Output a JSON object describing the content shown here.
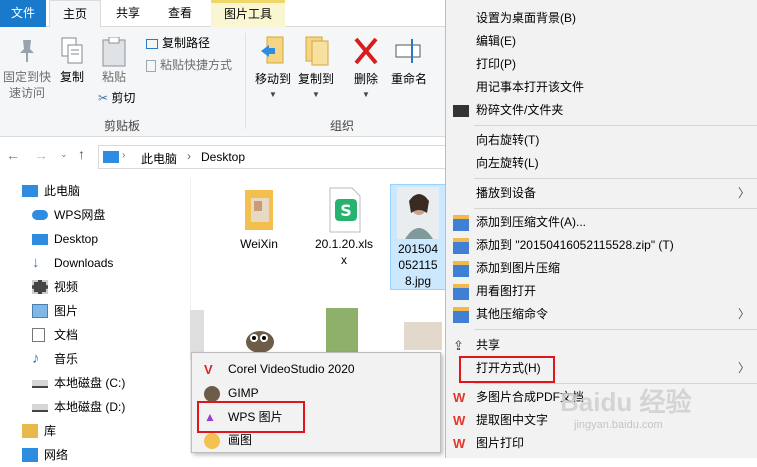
{
  "tabs": {
    "file": "文件",
    "home": "主页",
    "share": "共享",
    "view": "查看",
    "picture_tools": "图片工具"
  },
  "ribbon": {
    "pin_label_1": "固定到快",
    "pin_label_2": "速访问",
    "copy": "复制",
    "paste": "粘贴",
    "copy_path": "复制路径",
    "paste_shortcut": "粘贴快捷方式",
    "cut": "剪切",
    "clipboard_group": "剪贴板",
    "move_to": "移动到",
    "copy_to": "复制到",
    "delete": "删除",
    "rename": "重命名",
    "organize_group": "组织"
  },
  "address": {
    "path1": "此电脑",
    "sep": "›",
    "path2": "Desktop"
  },
  "tree": [
    "此电脑",
    "WPS网盘",
    "Desktop",
    "Downloads",
    "视频",
    "图片",
    "文档",
    "音乐",
    "本地磁盘 (C:)",
    "本地磁盘 (D:)",
    "库",
    "网络"
  ],
  "files": [
    {
      "name": "WeiXin"
    },
    {
      "name1": "20.1.20.xls",
      "name2": "x"
    },
    {
      "name1": "201504",
      "name2": "052115",
      "name3": "8.jpg"
    }
  ],
  "context_menu": [
    "设置为桌面背景(B)",
    "编辑(E)",
    "打印(P)",
    "用记事本打开该文件",
    "粉碎文件/文件夹",
    "向右旋转(T)",
    "向左旋转(L)",
    "播放到设备",
    "添加到压缩文件(A)...",
    "添加到 \"20150416052115528.zip\" (T)",
    "添加到图片压缩",
    "用看图打开",
    "其他压缩命令",
    "共享",
    "打开方式(H)",
    "多图片合成PDF文档",
    "提取图中文字",
    "图片打印"
  ],
  "submenu": [
    "Corel VideoStudio 2020",
    "GIMP",
    "WPS 图片",
    "画图"
  ],
  "watermark": "Baidu 经验",
  "watermark_sub": "jingyan.baidu.com",
  "colors": {
    "accent": "#1979ca",
    "highlight_box": "#e0161b",
    "menu_bg": "#f2f2f2",
    "selected_file": "#cce8ff"
  }
}
